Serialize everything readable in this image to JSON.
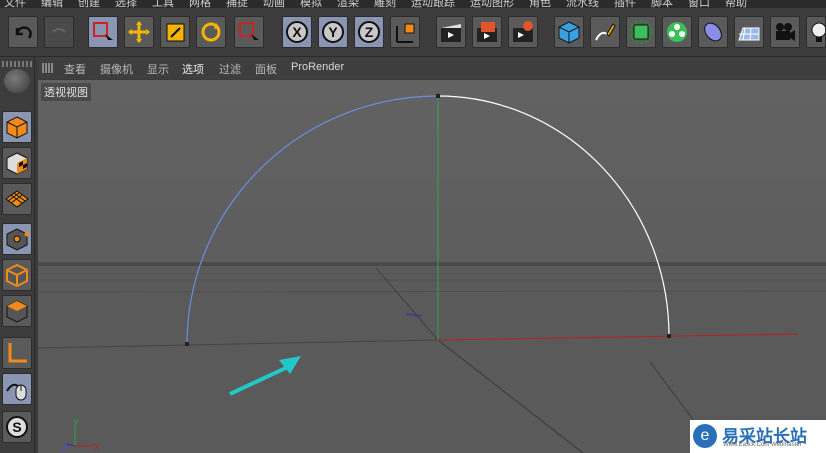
{
  "menubar": {
    "items": [
      "文件",
      "编辑",
      "创建",
      "选择",
      "工具",
      "网格",
      "捕捉",
      "动画",
      "模拟",
      "渲染",
      "雕刻",
      "运动跟踪",
      "运动图形",
      "角色",
      "流水线",
      "插件",
      "脚本",
      "窗口",
      "帮助"
    ]
  },
  "toolbar": {
    "tools": [
      "undo-icon",
      "redo-icon",
      "live-select-icon",
      "move-icon",
      "scale-icon",
      "rotate-icon",
      "recent-tools-icon",
      "x-axis-lock-icon",
      "y-axis-lock-icon",
      "z-axis-lock-icon",
      "world-coordinate-icon",
      "render-view-icon",
      "render-picture-viewer-icon",
      "render-settings-icon",
      "cube-icon",
      "pen-spline-icon",
      "subdivision-icon",
      "cloner-icon",
      "deformer-icon",
      "floor-icon",
      "camera-icon",
      "light-icon"
    ],
    "axis_labels": [
      "X",
      "Y",
      "Z"
    ]
  },
  "left_panel": {
    "tools": [
      "make-editable-icon",
      "model-mode-icon",
      "texture-mode-icon",
      "workplane-icon",
      "points-mode-icon",
      "edges-mode-icon",
      "polygons-mode-icon",
      "axis-mode-icon",
      "tweak-mode-icon",
      "snap-icon"
    ]
  },
  "viewport_menu": {
    "items": [
      "查看",
      "摄像机",
      "显示",
      "选项",
      "过滤",
      "面板",
      "ProRender"
    ],
    "active": "选项"
  },
  "viewport": {
    "label": "透视视图",
    "axis_gizmo": {
      "y": "Y",
      "x": "X",
      "z": "Z"
    },
    "colors": {
      "spline": "#ffffff",
      "spline_start": "#6a8ee0",
      "y_axis": "#2ea84a",
      "x_axis": "#b82020",
      "arrow": "#22c8c8",
      "horizon": "#4a4a4a"
    }
  },
  "watermark": {
    "text": "易采站长站",
    "sub": "Www.Easck.Com Webmaster"
  }
}
